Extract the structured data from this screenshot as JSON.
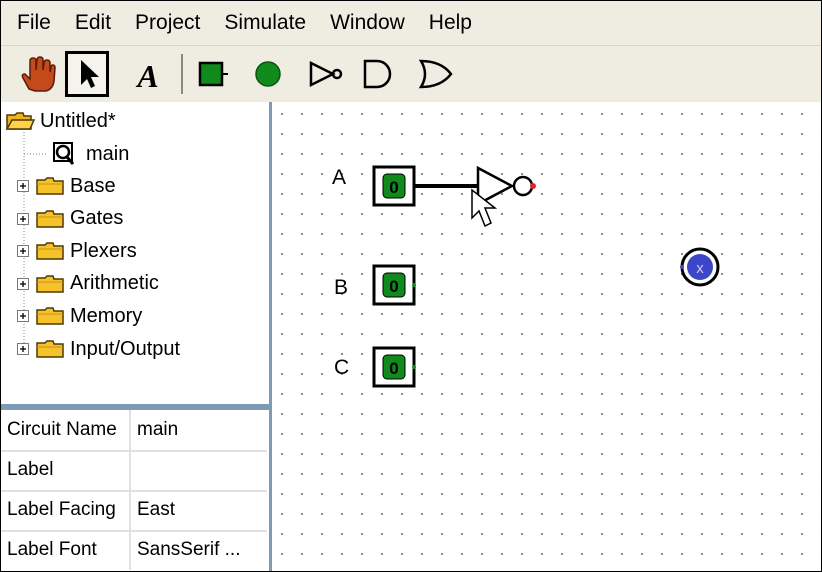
{
  "menu": {
    "items": [
      "File",
      "Edit",
      "Project",
      "Simulate",
      "Window",
      "Help"
    ]
  },
  "toolbar": {
    "tools": [
      {
        "name": "poke-tool",
        "icon": "hand-icon"
      },
      {
        "name": "select-tool",
        "icon": "arrow-pointer-icon",
        "selected": true
      },
      {
        "name": "text-tool",
        "icon": "letter-a-icon",
        "glyph": "A"
      },
      {
        "name": "input-pin-tool",
        "icon": "input-pin-icon"
      },
      {
        "name": "output-pin-tool",
        "icon": "output-pin-icon"
      },
      {
        "name": "not-gate-tool",
        "icon": "not-gate-icon"
      },
      {
        "name": "and-gate-tool",
        "icon": "and-gate-icon"
      },
      {
        "name": "or-gate-tool",
        "icon": "or-gate-icon"
      }
    ]
  },
  "explorer": {
    "project": "Untitled*",
    "circuit": "main",
    "libraries": [
      "Base",
      "Gates",
      "Plexers",
      "Arithmetic",
      "Memory",
      "Input/Output"
    ]
  },
  "properties": [
    {
      "key": "Circuit Name",
      "value": "main"
    },
    {
      "key": "Label",
      "value": ""
    },
    {
      "key": "Label Facing",
      "value": "East"
    },
    {
      "key": "Label Font",
      "value": "SansSerif ..."
    }
  ],
  "canvas": {
    "pins": [
      {
        "label": "A",
        "value": "0"
      },
      {
        "label": "B",
        "value": "0"
      },
      {
        "label": "C",
        "value": "0"
      }
    ],
    "output_pin_value": "x"
  },
  "colors": {
    "chrome": "#efede2",
    "panel_border": "#7e9bb6",
    "pin_green": "#118a1c",
    "output_blue": "#3c46c8",
    "wire_end_red": "#e0242a"
  }
}
